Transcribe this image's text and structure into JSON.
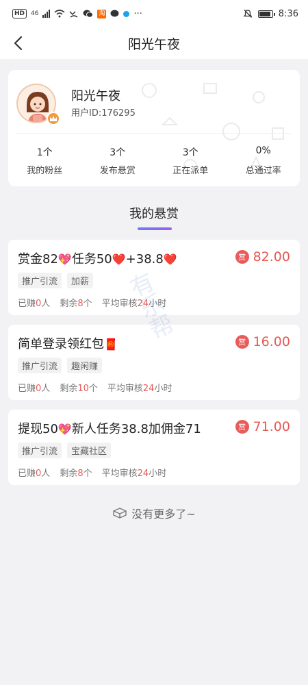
{
  "status_bar": {
    "time": "8:36",
    "network": "46",
    "hd": "HD",
    "app_badge": "淘",
    "more": "···"
  },
  "nav": {
    "title": "阳光午夜"
  },
  "profile": {
    "name": "阳光午夜",
    "user_id": "用户ID:176295",
    "badge_icon": "crown-icon",
    "stats": [
      {
        "value": "1个",
        "label": "我的粉丝"
      },
      {
        "value": "3个",
        "label": "发布悬赏"
      },
      {
        "value": "3个",
        "label": "正在派单"
      },
      {
        "value": "0%",
        "label": "总通过率"
      }
    ]
  },
  "section": {
    "title": "我的悬赏"
  },
  "tasks": [
    {
      "title_parts": [
        "赏金82",
        "💖",
        "任务50",
        "❤️",
        "+38.8",
        "❤️"
      ],
      "reward_icon": "赏",
      "amount": "82.00",
      "tags": [
        "推广引流",
        "加薪"
      ],
      "earned_label": "已赚",
      "earned_value": "0",
      "earned_unit": "人",
      "remain_label": "剩余",
      "remain_value": "8",
      "remain_unit": "个",
      "review_label": "平均审核",
      "review_value": "24",
      "review_unit": "小时"
    },
    {
      "title_parts": [
        "简单登录领红包",
        "🧧"
      ],
      "reward_icon": "赏",
      "amount": "16.00",
      "tags": [
        "推广引流",
        "趣闲赚"
      ],
      "earned_label": "已赚",
      "earned_value": "0",
      "earned_unit": "人",
      "remain_label": "剩余",
      "remain_value": "10",
      "remain_unit": "个",
      "review_label": "平均审核",
      "review_value": "24",
      "review_unit": "小时"
    },
    {
      "title_parts": [
        "提现50",
        "💖",
        "新人任务38.8加佣金71"
      ],
      "reward_icon": "赏",
      "amount": "71.00",
      "tags": [
        "推广引流",
        "宝藏社区"
      ],
      "earned_label": "已赚",
      "earned_value": "0",
      "earned_unit": "人",
      "remain_label": "剩余",
      "remain_value": "8",
      "remain_unit": "个",
      "review_label": "平均审核",
      "review_value": "24",
      "review_unit": "小时"
    }
  ],
  "watermark": "有乐帮",
  "footer": {
    "text": "没有更多了~"
  },
  "colors": {
    "accent_red": "#e55a55",
    "underline_start": "#6a7cf5",
    "underline_end": "#9b5ef0",
    "badge_orange": "#f19a3e"
  }
}
